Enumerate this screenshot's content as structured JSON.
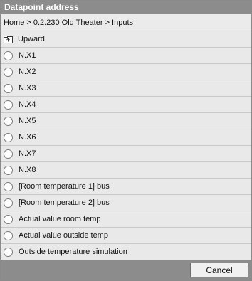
{
  "dialog": {
    "title": "Datapoint address",
    "breadcrumb": "Home > 0.2.230 Old Theater > Inputs",
    "upward_label": "Upward",
    "items": [
      {
        "label": "N.X1"
      },
      {
        "label": "N.X2"
      },
      {
        "label": "N.X3"
      },
      {
        "label": "N.X4"
      },
      {
        "label": "N.X5"
      },
      {
        "label": "N.X6"
      },
      {
        "label": "N.X7"
      },
      {
        "label": "N.X8"
      },
      {
        "label": "[Room temperature 1] bus"
      },
      {
        "label": "[Room temperature 2] bus"
      },
      {
        "label": "Actual value room temp"
      },
      {
        "label": "Actual value outside temp"
      },
      {
        "label": "Outside temperature simulation"
      }
    ],
    "cancel_label": "Cancel"
  },
  "colors": {
    "titlebar": "#8c8c8c",
    "background": "#e9e9e9",
    "row_separator": "#c8c8c8"
  },
  "icons": {
    "upward": "folder-up-icon",
    "item": "radio-icon"
  }
}
